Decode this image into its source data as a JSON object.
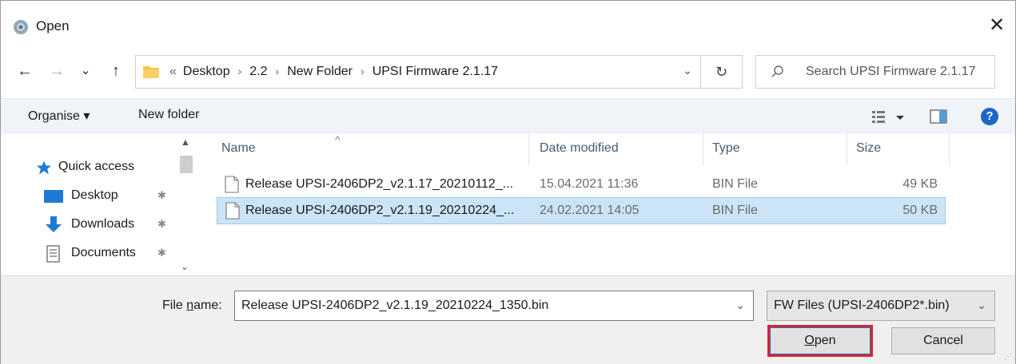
{
  "window": {
    "title": "Open",
    "close_glyph": "✕"
  },
  "nav": {
    "back_glyph": "←",
    "forward_glyph": "→",
    "recent_glyph": "⌄",
    "up_glyph": "↑",
    "breadcrumb_lead": "«",
    "breadcrumbs": [
      "Desktop",
      "2.2",
      "New Folder",
      "UPSI Firmware 2.1.17"
    ],
    "crumb_sep": "›",
    "address_drop": "⌄",
    "refresh_glyph": "↻",
    "search_placeholder": "Search UPSI Firmware 2.1.17"
  },
  "toolbar": {
    "organise_label": "Organise ▾",
    "new_folder_label": "New folder",
    "help_label": "?"
  },
  "sidebar": {
    "items": [
      {
        "label": "Quick access",
        "icon": "star-icon"
      },
      {
        "label": "Desktop",
        "icon": "desktop-icon",
        "pinned": true
      },
      {
        "label": "Downloads",
        "icon": "downloads-icon",
        "pinned": true
      },
      {
        "label": "Documents",
        "icon": "documents-icon",
        "pinned": true
      }
    ],
    "pin_glyph": "📌"
  },
  "files": {
    "columns": [
      "Name",
      "Date modified",
      "Type",
      "Size"
    ],
    "sort_glyph": "^",
    "rows": [
      {
        "name": "Release UPSI-2406DP2_v2.1.17_20210112_...",
        "date": "15.04.2021 11:36",
        "type": "BIN File",
        "size": "49 KB",
        "selected": false
      },
      {
        "name": "Release UPSI-2406DP2_v2.1.19_20210224_...",
        "date": "24.02.2021 14:05",
        "type": "BIN File",
        "size": "50 KB",
        "selected": true
      }
    ]
  },
  "footer": {
    "file_name_label_pre": "File ",
    "file_name_label_underline": "n",
    "file_name_label_post": "ame:",
    "file_name_value": "Release UPSI-2406DP2_v2.1.19_20210224_1350.bin",
    "filter_value": "FW Files (UPSI-2406DP2*.bin)",
    "dropdown_glyph": "⌄",
    "open_label_underline": "O",
    "open_label_rest": "pen",
    "cancel_label": "Cancel"
  },
  "colors": {
    "accent": "#0078d7",
    "highlight_border": "#e4202b",
    "selection": "#cce4f7",
    "help": "#1e66c8",
    "folder": "#f4c542"
  }
}
